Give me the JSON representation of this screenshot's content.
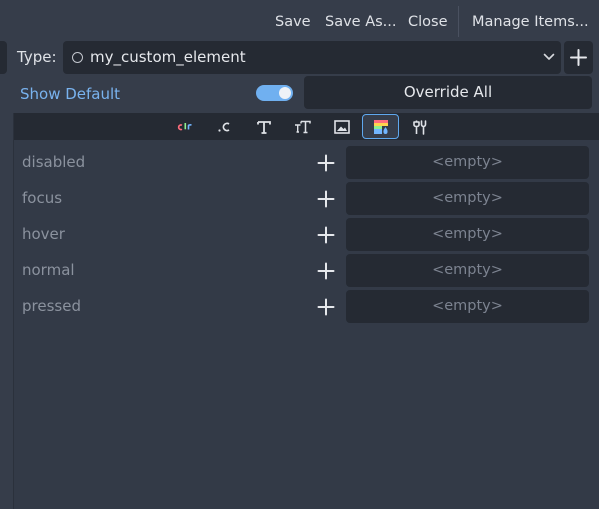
{
  "toolbar": {
    "save": "Save",
    "save_as": "Save As...",
    "close": "Close",
    "manage_items": "Manage Items..."
  },
  "type_row": {
    "label": "Type:",
    "value": "my_custom_element"
  },
  "show_default": {
    "label": "Show Default",
    "enabled": true
  },
  "override_all": "Override All",
  "tabs": [
    {
      "icon": "color-icon",
      "active": false
    },
    {
      "icon": "constant-icon",
      "active": false
    },
    {
      "icon": "font-icon",
      "active": false
    },
    {
      "icon": "font-size-icon",
      "active": false
    },
    {
      "icon": "texture-icon",
      "active": false
    },
    {
      "icon": "stylebox-icon",
      "active": true
    },
    {
      "icon": "theme-type-icon",
      "active": false
    }
  ],
  "items": [
    {
      "name": "disabled",
      "value": "<empty>"
    },
    {
      "name": "focus",
      "value": "<empty>"
    },
    {
      "name": "hover",
      "value": "<empty>"
    },
    {
      "name": "normal",
      "value": "<empty>"
    },
    {
      "name": "pressed",
      "value": "<empty>"
    }
  ],
  "colors": {
    "accent": "#70b0f0",
    "link": "#79b3ef",
    "background": "#363d4a",
    "field": "#252a33"
  }
}
